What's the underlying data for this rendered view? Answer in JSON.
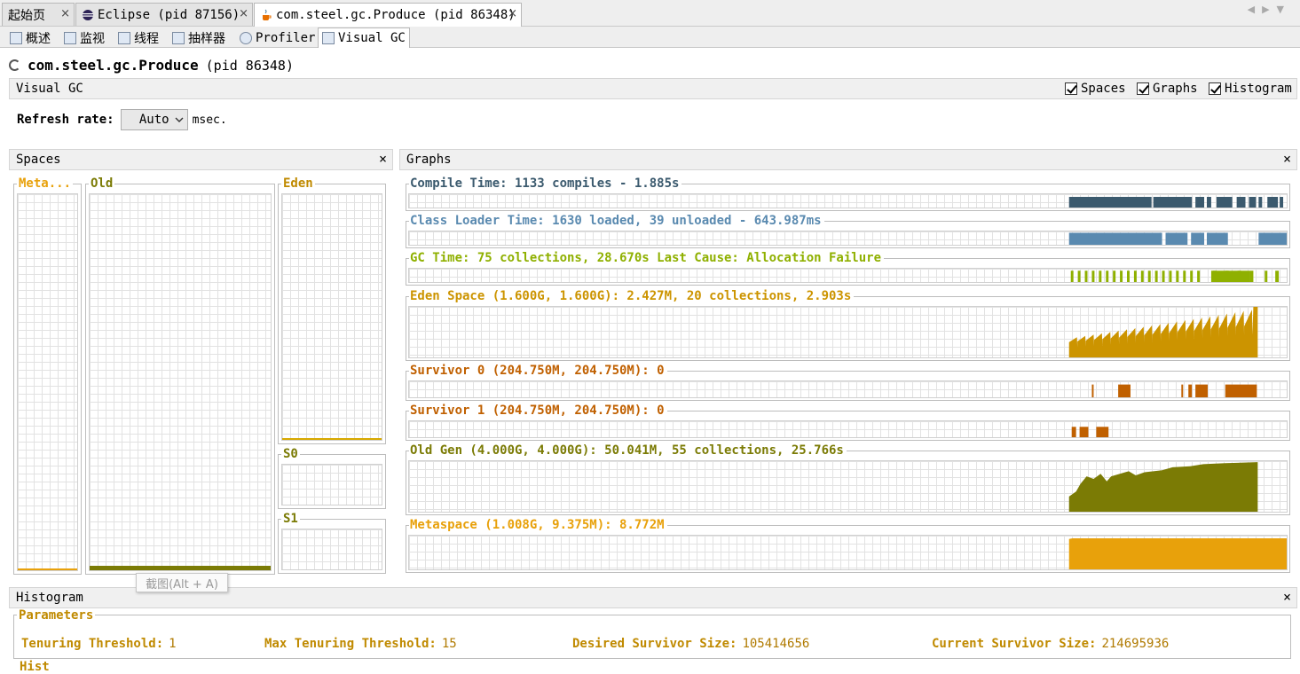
{
  "doc_tabs": [
    {
      "label": "起始页"
    },
    {
      "label": "Eclipse (pid 87156)"
    },
    {
      "label": "com.steel.gc.Produce (pid 86348)"
    }
  ],
  "sub_tabs": [
    {
      "label": "概述"
    },
    {
      "label": "监视"
    },
    {
      "label": "线程"
    },
    {
      "label": "抽样器"
    },
    {
      "label": "Profiler"
    },
    {
      "label": "Visual GC"
    }
  ],
  "process": {
    "name": "com.steel.gc.Produce",
    "pid": "(pid 86348)"
  },
  "vgc_bar": {
    "label": "Visual GC",
    "checkboxes": [
      {
        "label": "Spaces",
        "checked": true
      },
      {
        "label": "Graphs",
        "checked": true
      },
      {
        "label": "Histogram",
        "checked": true
      }
    ]
  },
  "refresh": {
    "label": "Refresh rate:",
    "value": "Auto",
    "unit": "msec."
  },
  "spaces_panel": {
    "title": "Spaces",
    "spaces": [
      {
        "label": "Meta...",
        "usage": 0.005,
        "color": "#e8a10b"
      },
      {
        "label": "Old",
        "usage": 0.012,
        "color": "#7b7b05"
      },
      {
        "label": "Eden",
        "usage": 0.004,
        "color": "#d8a900"
      },
      {
        "label": "S0",
        "usage": 0.0,
        "color": "#c06000"
      },
      {
        "label": "S1",
        "usage": 0.0,
        "color": "#c06000"
      }
    ]
  },
  "graphs_panel": {
    "title": "Graphs",
    "graphs": [
      {
        "label": "Compile Time: 1133 compiles - 1.885s",
        "color": "#3b5a6e"
      },
      {
        "label": "Class Loader Time: 1630 loaded, 39 unloaded - 643.987ms",
        "color": "#5a8ab0"
      },
      {
        "label": "GC Time: 75 collections, 28.670s  Last Cause: Allocation Failure",
        "color": "#8fb000"
      },
      {
        "label": "Eden Space (1.600G, 1.600G): 2.427M, 20 collections, 2.903s",
        "color": "#cc9400"
      },
      {
        "label": "Survivor 0 (204.750M, 204.750M): 0",
        "color": "#c06000"
      },
      {
        "label": "Survivor 1 (204.750M, 204.750M): 0",
        "color": "#c06000"
      },
      {
        "label": "Old Gen (4.000G, 4.000G): 50.041M, 55 collections, 25.766s",
        "color": "#7b7b05"
      },
      {
        "label": "Metaspace (1.008G, 9.375M): 8.772M",
        "color": "#e8a10b"
      }
    ]
  },
  "histogram_panel": {
    "title": "Histogram",
    "parameters_label": "Parameters",
    "parameters": [
      {
        "key": "Tenuring Threshold:",
        "value": "1"
      },
      {
        "key": "Max Tenuring Threshold:",
        "value": "15"
      },
      {
        "key": "Desired Survivor Size:",
        "value": "105414656"
      },
      {
        "key": "Current Survivor Size:",
        "value": "214695936"
      }
    ],
    "cut_label": "Hist"
  },
  "tooltip": {
    "text": "截图(Alt + A)"
  },
  "close_glyph": "×"
}
